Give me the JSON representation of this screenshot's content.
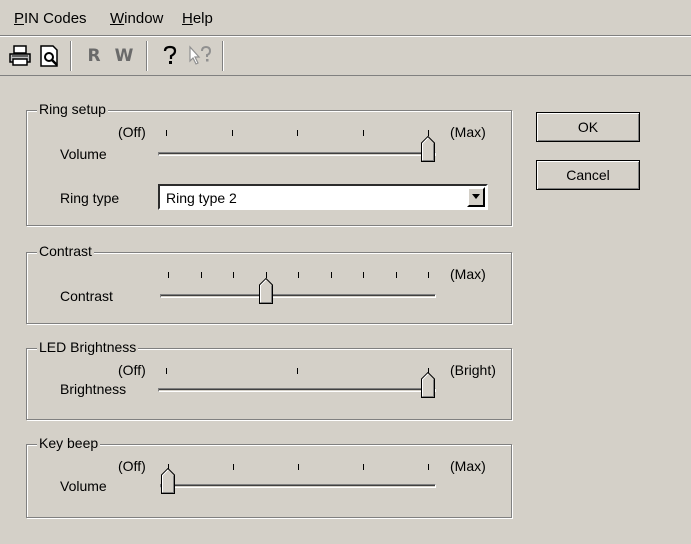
{
  "menu": {
    "pin_codes": {
      "accel": "P",
      "rest": "IN Codes"
    },
    "window": {
      "accel": "W",
      "rest": "indow"
    },
    "help": {
      "accel": "H",
      "rest": "elp"
    }
  },
  "toolbar": {
    "print_icon": "printer-icon",
    "preview_icon": "print-preview-icon",
    "read_label": "R",
    "write_label": "W",
    "help_icon": "help-icon",
    "context_help_icon": "context-help-icon"
  },
  "ring_setup": {
    "title": "Ring setup",
    "volume_label": "Volume",
    "min_label": "(Off)",
    "max_label": "(Max)",
    "volume_value": 4,
    "volume_max": 4,
    "ring_type_label": "Ring type",
    "ring_type_value": "Ring type 2"
  },
  "contrast": {
    "title": "Contrast",
    "label": "Contrast",
    "max_label": "(Max)",
    "value": 3,
    "max": 8
  },
  "led_brightness": {
    "title": "LED Brightness",
    "label": "Brightness",
    "min_label": "(Off)",
    "max_label": "(Bright)",
    "value": 2,
    "max": 2
  },
  "key_beep": {
    "title": "Key beep",
    "label": "Volume",
    "min_label": "(Off)",
    "max_label": "(Max)",
    "value": 0,
    "max": 4
  },
  "buttons": {
    "ok": "OK",
    "cancel": "Cancel"
  }
}
